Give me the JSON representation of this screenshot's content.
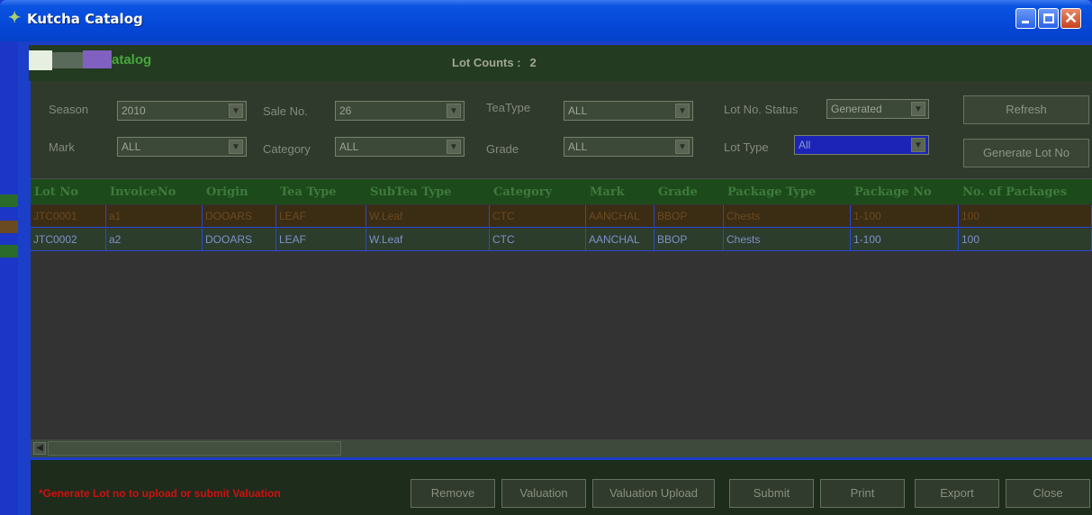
{
  "window": {
    "title": "Kutcha Catalog",
    "icon": "leaf-app-icon",
    "controls": [
      "minimize-icon",
      "maximize-icon",
      "close-icon"
    ]
  },
  "topbar": {
    "logo_text": "atalog",
    "lot_counts_label": "Lot Counts :",
    "lot_counts_value": "2"
  },
  "filters": {
    "season": {
      "label": "Season",
      "value": "2010"
    },
    "sale_no": {
      "label": "Sale No.",
      "value": "26"
    },
    "tea_type": {
      "label": "TeaType",
      "value": "ALL"
    },
    "lot_no_status": {
      "label": "Lot No. Status",
      "value": "Generated"
    },
    "mark": {
      "label": "Mark",
      "value": "ALL"
    },
    "category": {
      "label": "Category",
      "value": "ALL"
    },
    "grade": {
      "label": "Grade",
      "value": "ALL"
    },
    "lot_type": {
      "label": "Lot Type",
      "value": "All"
    },
    "refresh_label": "Refresh",
    "generate_label": "Generate Lot No"
  },
  "grid": {
    "columns": [
      "Lot No",
      "InvoiceNo",
      "Origin",
      "Tea Type",
      "SubTea Type",
      "Category",
      "Mark",
      "Grade",
      "Package Type",
      "Package No",
      "No. of Packages"
    ],
    "rows": [
      [
        "JTC0001",
        "a1",
        "DOOARS",
        "LEAF",
        "W.Leaf",
        "CTC",
        "AANCHAL",
        "BBOP",
        "Chests",
        "1-100",
        "100"
      ],
      [
        "JTC0002",
        "a2",
        "DOOARS",
        "LEAF",
        "W.Leaf",
        "CTC",
        "AANCHAL",
        "BBOP",
        "Chests",
        "1-100",
        "100"
      ]
    ]
  },
  "footer": {
    "warning": "*Generate Lot no to upload or submit Valuation",
    "buttons": [
      "Remove",
      "Valuation",
      "Valuation Upload",
      "Submit",
      "Print",
      "Export",
      "Close"
    ]
  },
  "colors": {
    "titlebar": "#0548d8",
    "warning_text": "#d01010"
  }
}
